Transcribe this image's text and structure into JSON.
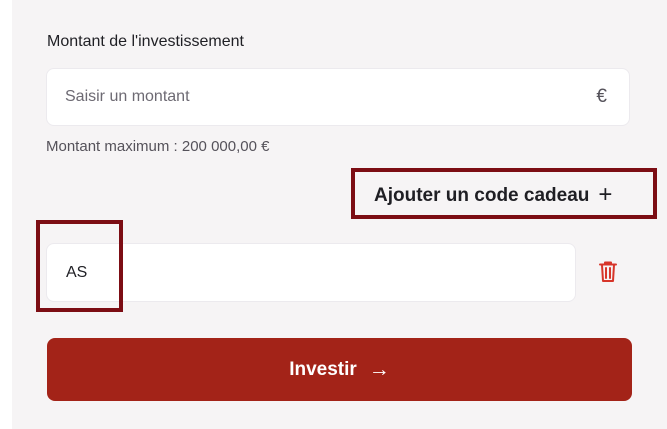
{
  "form": {
    "amount_label": "Montant de l'investissement",
    "amount_placeholder": "Saisir un montant",
    "amount_value": "",
    "currency_symbol": "€",
    "max_amount_text": "Montant maximum : 200 000,00 €",
    "gift_button_label": "Ajouter un code cadeau",
    "gift_button_icon": "plus-icon",
    "gift_code_value": "AS",
    "delete_icon": "trash-icon",
    "invest_button_label": "Investir",
    "invest_button_icon": "arrow-right-icon"
  },
  "colors": {
    "primary": "#a32318",
    "highlight": "#7c0d14",
    "danger": "#d7352a",
    "background": "#f6f4f5"
  }
}
